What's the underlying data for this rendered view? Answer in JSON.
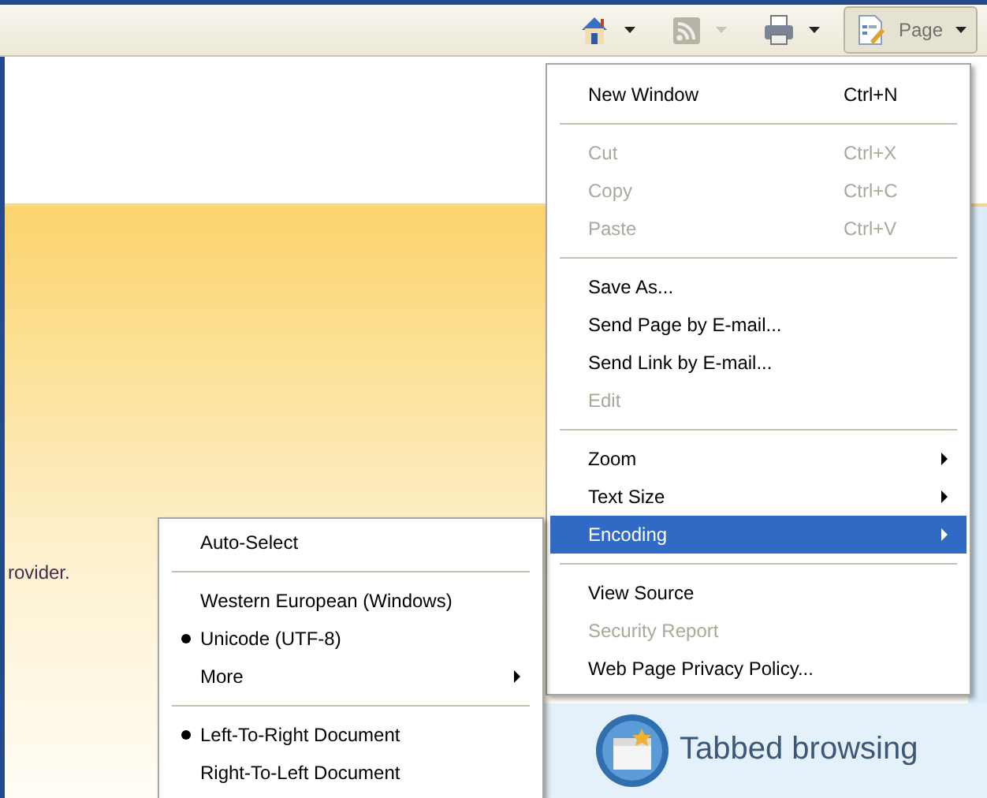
{
  "toolbar": {
    "items": [
      {
        "kind": "home",
        "dropdown": true,
        "disabled": false
      },
      {
        "kind": "feed",
        "dropdown": true,
        "disabled": true
      },
      {
        "kind": "print",
        "dropdown": true,
        "disabled": false
      },
      {
        "kind": "page",
        "label": "Page",
        "dropdown": true,
        "disabled": false,
        "pressed": true
      }
    ]
  },
  "page": {
    "text": "rovider.",
    "feature": {
      "title": "Tabbed browsing"
    }
  },
  "menu": {
    "items": [
      {
        "kind": "item",
        "label": "New Window",
        "shortcut": "Ctrl+N",
        "disabled": false,
        "submenu": false,
        "selected": false
      },
      {
        "kind": "separator"
      },
      {
        "kind": "item",
        "label": "Cut",
        "shortcut": "Ctrl+X",
        "disabled": true,
        "submenu": false,
        "selected": false
      },
      {
        "kind": "item",
        "label": "Copy",
        "shortcut": "Ctrl+C",
        "disabled": true,
        "submenu": false,
        "selected": false
      },
      {
        "kind": "item",
        "label": "Paste",
        "shortcut": "Ctrl+V",
        "disabled": true,
        "submenu": false,
        "selected": false
      },
      {
        "kind": "separator"
      },
      {
        "kind": "item",
        "label": "Save As...",
        "disabled": false,
        "submenu": false,
        "selected": false
      },
      {
        "kind": "item",
        "label": "Send Page by E-mail...",
        "disabled": false,
        "submenu": false,
        "selected": false
      },
      {
        "kind": "item",
        "label": "Send Link by E-mail...",
        "disabled": false,
        "submenu": false,
        "selected": false
      },
      {
        "kind": "item",
        "label": "Edit",
        "disabled": true,
        "submenu": false,
        "selected": false
      },
      {
        "kind": "separator"
      },
      {
        "kind": "item",
        "label": "Zoom",
        "disabled": false,
        "submenu": true,
        "selected": false
      },
      {
        "kind": "item",
        "label": "Text Size",
        "disabled": false,
        "submenu": true,
        "selected": false
      },
      {
        "kind": "item",
        "label": "Encoding",
        "disabled": false,
        "submenu": true,
        "selected": true
      },
      {
        "kind": "separator"
      },
      {
        "kind": "item",
        "label": "View Source",
        "disabled": false,
        "submenu": false,
        "selected": false
      },
      {
        "kind": "item",
        "label": "Security Report",
        "disabled": true,
        "submenu": false,
        "selected": false
      },
      {
        "kind": "item",
        "label": "Web Page Privacy Policy...",
        "disabled": false,
        "submenu": false,
        "selected": false
      }
    ]
  },
  "submenu": {
    "items": [
      {
        "kind": "item",
        "label": "Auto-Select",
        "checked": false,
        "submenu": false
      },
      {
        "kind": "separator"
      },
      {
        "kind": "item",
        "label": "Western European (Windows)",
        "checked": false,
        "submenu": false
      },
      {
        "kind": "item",
        "label": "Unicode (UTF-8)",
        "checked": true,
        "submenu": false
      },
      {
        "kind": "item",
        "label": "More",
        "checked": false,
        "submenu": true
      },
      {
        "kind": "separator"
      },
      {
        "kind": "item",
        "label": "Left-To-Right Document",
        "checked": true,
        "submenu": false
      },
      {
        "kind": "item",
        "label": "Right-To-Left Document",
        "checked": false,
        "submenu": false
      }
    ]
  }
}
